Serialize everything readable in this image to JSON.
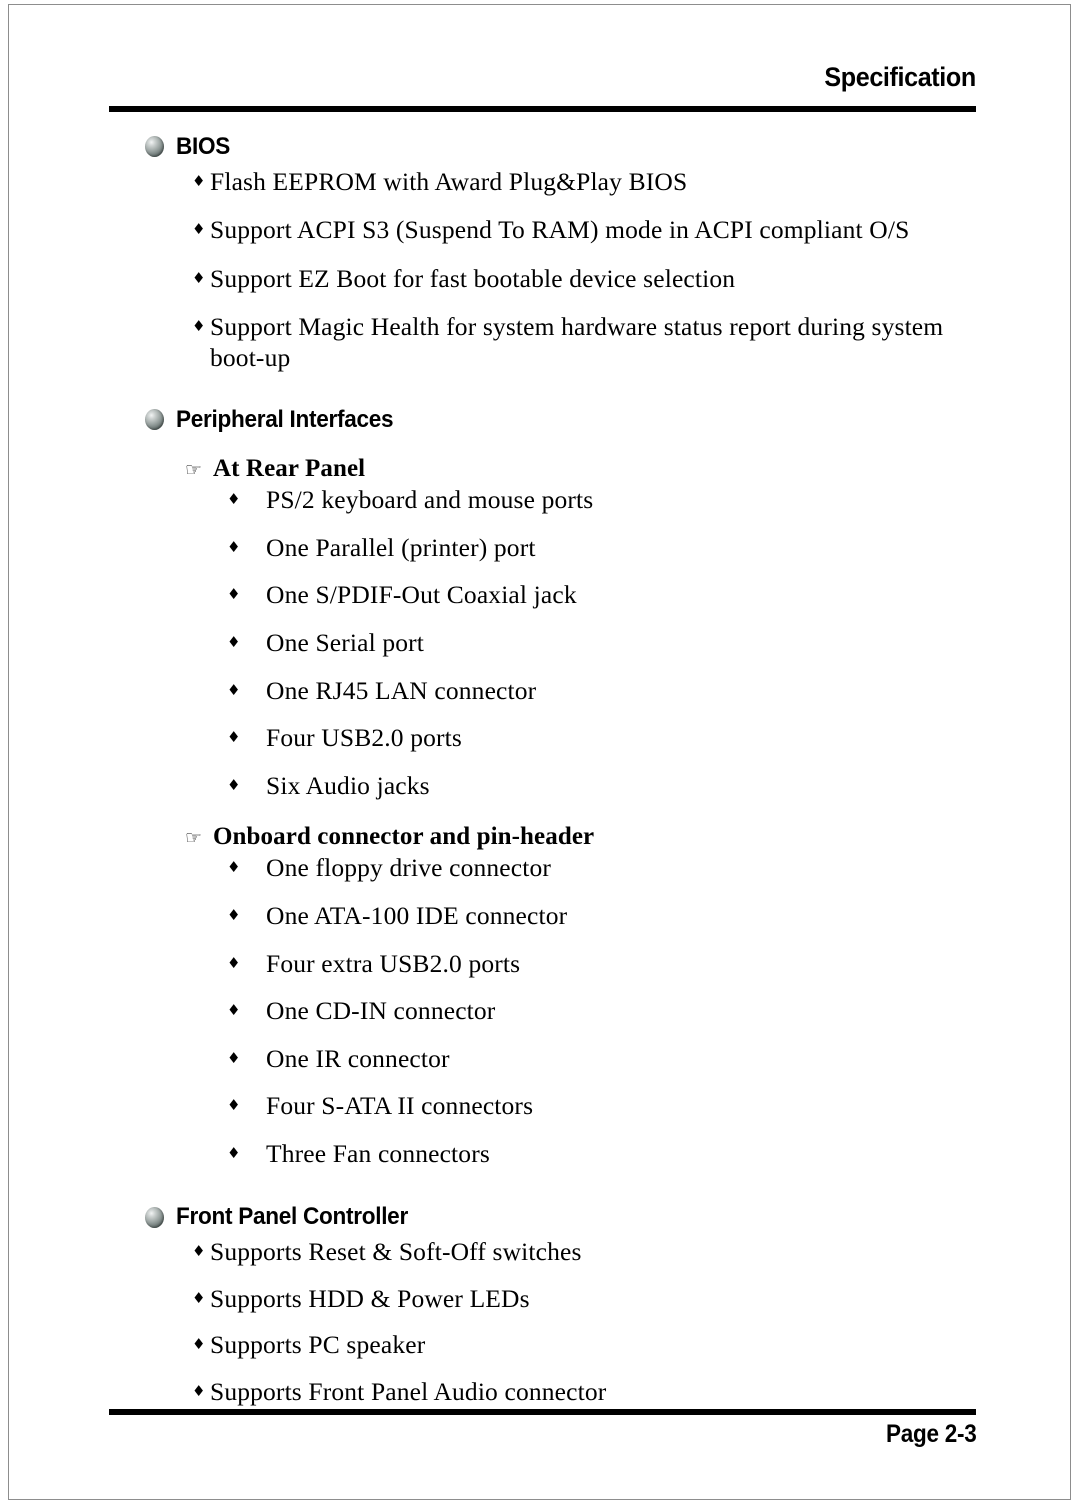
{
  "header": {
    "title": "Specification"
  },
  "footer": {
    "page_label": "Page 2-3"
  },
  "icons": {
    "sphere": "sphere-bullet",
    "hand": "☞",
    "diamond": "♦"
  },
  "sections": [
    {
      "title": "BIOS",
      "items": [
        "Flash EEPROM with Award Plug&Play BIOS",
        "Support ACPI S3 (Suspend To RAM) mode in ACPI compliant O/S",
        "Support EZ Boot for fast bootable device selection",
        "Support Magic Health for system hardware status report during system boot-up"
      ]
    },
    {
      "title": "Peripheral Interfaces",
      "subsections": [
        {
          "title": "At Rear Panel",
          "items": [
            "PS/2 keyboard and mouse ports",
            "One Parallel (printer) port",
            "One S/PDIF-Out Coaxial jack",
            "One Serial port",
            "One RJ45 LAN connector",
            "Four USB2.0 ports",
            "Six Audio jacks"
          ]
        },
        {
          "title": "Onboard connector and pin-header",
          "items": [
            "One floppy drive connector",
            "One ATA-100 IDE connector",
            "Four extra USB2.0 ports",
            "One CD-IN connector",
            "One IR connector",
            "Four S-ATA II connectors",
            "Three Fan connectors"
          ]
        }
      ]
    },
    {
      "title": "Front Panel Controller",
      "items": [
        "Supports Reset & Soft-Off switches",
        "Supports HDD & Power LEDs",
        "Supports PC speaker",
        "Supports Front Panel Audio connector"
      ]
    }
  ]
}
